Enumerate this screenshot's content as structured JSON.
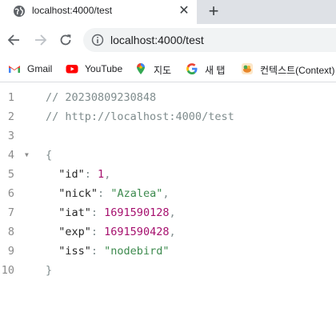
{
  "tab": {
    "title": "localhost:4000/test",
    "close_glyph": "✕",
    "new_tab_glyph": "+"
  },
  "toolbar": {
    "url": "localhost:4000/test"
  },
  "bookmarks": [
    {
      "label": "Gmail",
      "icon": "gmail-icon"
    },
    {
      "label": "YouTube",
      "icon": "youtube-icon"
    },
    {
      "label": "지도",
      "icon": "maps-icon"
    },
    {
      "label": "새 탭",
      "icon": "google-icon"
    },
    {
      "label": "컨텍스트(Context)",
      "icon": "context-icon"
    }
  ],
  "code": {
    "line_numbers": [
      "1",
      "2",
      "3",
      "4",
      "5",
      "6",
      "7",
      "8",
      "9",
      "10"
    ],
    "comment_timestamp": "// 20230809230848",
    "comment_url": "// http://localhost:4000/test",
    "open_brace": "{",
    "close_brace": "}",
    "fields": [
      {
        "key": "\"id\"",
        "value": "1",
        "comma": ",",
        "type": "number"
      },
      {
        "key": "\"nick\"",
        "value": "\"Azalea\"",
        "comma": ",",
        "type": "string"
      },
      {
        "key": "\"iat\"",
        "value": "1691590128",
        "comma": ",",
        "type": "number"
      },
      {
        "key": "\"exp\"",
        "value": "1691590428",
        "comma": ",",
        "type": "number"
      },
      {
        "key": "\"iss\"",
        "value": "\"nodebird\"",
        "comma": "",
        "type": "string"
      }
    ],
    "fold_glyph": "▼",
    "colon": ": "
  },
  "colors": {
    "tabstrip": "#dee1e6",
    "omnibox": "#f1f3f4",
    "number": "#a6106e",
    "string": "#3d8a4e",
    "comment": "#7f8c8d"
  }
}
